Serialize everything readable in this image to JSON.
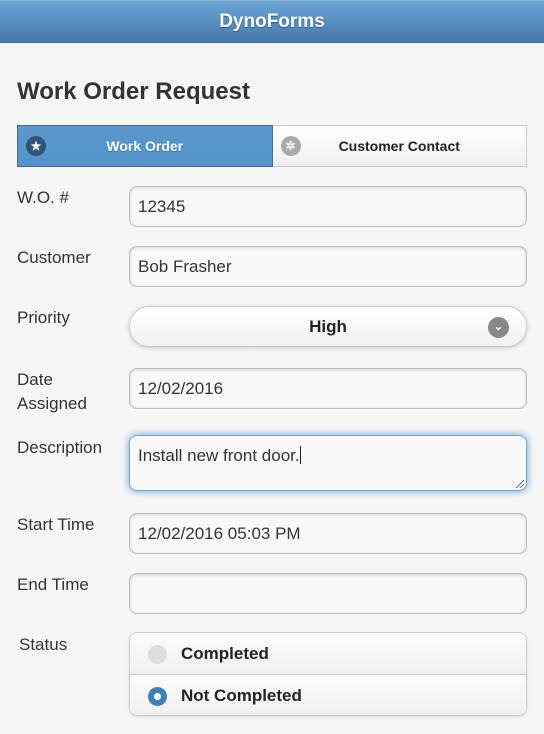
{
  "header": {
    "app_title": "DynoForms"
  },
  "page": {
    "title": "Work Order Request"
  },
  "tabs": [
    {
      "label": "Work Order",
      "icon": "star-icon",
      "active": true
    },
    {
      "label": "Customer Contact",
      "icon": "gear-icon",
      "active": false
    }
  ],
  "fields": {
    "wo_number": {
      "label": "W.O. #",
      "value": "12345"
    },
    "customer": {
      "label": "Customer",
      "value": "Bob Frasher"
    },
    "priority": {
      "label": "Priority",
      "value": "High"
    },
    "date_assigned": {
      "label_line1": "Date",
      "label_line2": "Assigned",
      "value": "12/02/2016"
    },
    "description": {
      "label": "Description",
      "value": "Install new front door."
    },
    "start_time": {
      "label": "Start Time",
      "value": "12/02/2016 05:03 PM"
    },
    "end_time": {
      "label": "End Time",
      "value": ""
    },
    "status": {
      "label": "Status",
      "options": [
        {
          "label": "Completed",
          "selected": false
        },
        {
          "label": "Not Completed",
          "selected": true
        }
      ]
    }
  }
}
